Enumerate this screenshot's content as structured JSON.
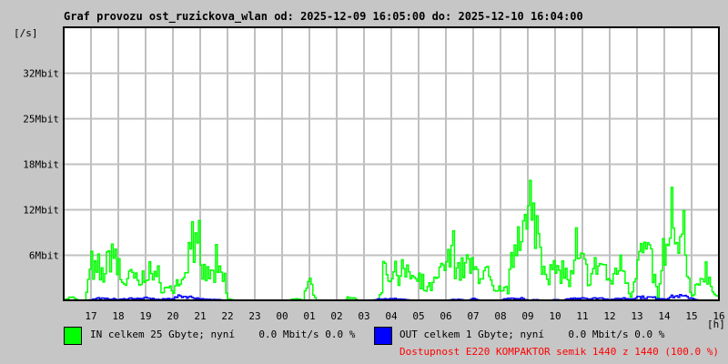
{
  "chart_data": {
    "type": "line",
    "title": "Graf provozu ost_ruzickova_wlan od: 2025-12-09 16:05:00 do: 2025-12-10 16:04:00",
    "ylabel": "[/s]",
    "xlabel": "[h]",
    "ylim_mbit": [
      0,
      38.4
    ],
    "y_ticks": [
      {
        "label": "6Mbit",
        "value": 6.4
      },
      {
        "label": "12Mbit",
        "value": 12.8
      },
      {
        "label": "18Mbit",
        "value": 19.2
      },
      {
        "label": "25Mbit",
        "value": 25.6
      },
      {
        "label": "32Mbit",
        "value": 32
      }
    ],
    "x_range_hours": [
      0,
      24
    ],
    "x_ticks": [
      {
        "label": "17",
        "hour": 1
      },
      {
        "label": "18",
        "hour": 2
      },
      {
        "label": "19",
        "hour": 3
      },
      {
        "label": "20",
        "hour": 4
      },
      {
        "label": "21",
        "hour": 5
      },
      {
        "label": "22",
        "hour": 6
      },
      {
        "label": "23",
        "hour": 7
      },
      {
        "label": "00",
        "hour": 8
      },
      {
        "label": "01",
        "hour": 9
      },
      {
        "label": "02",
        "hour": 10
      },
      {
        "label": "03",
        "hour": 11
      },
      {
        "label": "04",
        "hour": 12
      },
      {
        "label": "05",
        "hour": 13
      },
      {
        "label": "06",
        "hour": 14
      },
      {
        "label": "07",
        "hour": 15
      },
      {
        "label": "08",
        "hour": 16
      },
      {
        "label": "09",
        "hour": 17
      },
      {
        "label": "10",
        "hour": 18
      },
      {
        "label": "11",
        "hour": 19
      },
      {
        "label": "12",
        "hour": 20
      },
      {
        "label": "13",
        "hour": 21
      },
      {
        "label": "14",
        "hour": 22
      },
      {
        "label": "15",
        "hour": 23
      },
      {
        "label": "16",
        "hour": 24
      }
    ],
    "grid": true,
    "sample_step_hours": 0.25,
    "series": [
      {
        "name": "IN",
        "color": "#00ff00",
        "values": [
          0,
          0.5,
          0,
          0,
          5,
          3,
          4,
          7.5,
          3,
          2.5,
          3.5,
          2,
          4.5,
          3,
          2,
          1.5,
          1.5,
          1.5,
          6.5,
          8,
          4,
          3.5,
          3.5,
          3.5,
          0.2,
          0,
          0,
          0,
          0,
          0,
          0,
          0,
          0,
          0,
          0.3,
          0,
          2.5,
          0,
          0,
          0,
          0,
          0,
          0.5,
          0,
          0,
          0,
          0,
          3.5,
          3.8,
          3.8,
          3.5,
          3.5,
          1.8,
          1.5,
          2,
          3.5,
          5,
          6,
          4,
          5,
          4,
          4,
          3.5,
          1,
          1,
          1.5,
          8,
          13,
          7,
          12,
          6,
          4,
          3,
          4.5,
          2.5,
          5,
          5,
          3,
          5,
          5,
          2,
          5,
          4.5,
          0.5,
          6,
          7,
          5,
          0.5,
          6,
          8,
          7,
          6,
          0.5,
          3.5,
          2.5,
          2,
          0
        ]
      },
      {
        "name": "OUT",
        "color": "#0000ff",
        "values": [
          0,
          0,
          0,
          0,
          0.1,
          0.3,
          0.2,
          0.2,
          0.1,
          0.2,
          0.3,
          0.2,
          0.3,
          0.2,
          0.1,
          0.2,
          0.3,
          0.6,
          0.5,
          0.4,
          0.2,
          0.1,
          0.1,
          0.1,
          0,
          0,
          0,
          0,
          0,
          0,
          0,
          0,
          0,
          0,
          0,
          0,
          0,
          0,
          0,
          0,
          0,
          0,
          0,
          0,
          0,
          0,
          0.2,
          0.2,
          0.2,
          0.2,
          0.1,
          0,
          0,
          0,
          0,
          0,
          0,
          0.1,
          0.1,
          0,
          0.2,
          0,
          0,
          0,
          0,
          0.3,
          0.2,
          0.3,
          0,
          0.1,
          0,
          0,
          0.1,
          0,
          0.2,
          0.3,
          0.4,
          0.2,
          0.3,
          0.3,
          0.1,
          0.2,
          0.3,
          0.2,
          0.5,
          0.4,
          0.4,
          0.3,
          0.2,
          0.5,
          0.6,
          0.5,
          0.3,
          0,
          0,
          0,
          0
        ]
      }
    ]
  },
  "legend": {
    "in_text": "IN celkem 25 Gbyte; nyní    0.0 Mbit/s 0.0 %",
    "out_text": "OUT celkem 1 Gbyte; nyní    0.0 Mbit/s 0.0 %",
    "in_color": "#00ff00",
    "out_color": "#0000ff"
  },
  "availability": {
    "text": "Dostupnost E220 KOMPAKTOR semik 1440 z 1440 (100.0 %)",
    "color": "#ff0000"
  }
}
